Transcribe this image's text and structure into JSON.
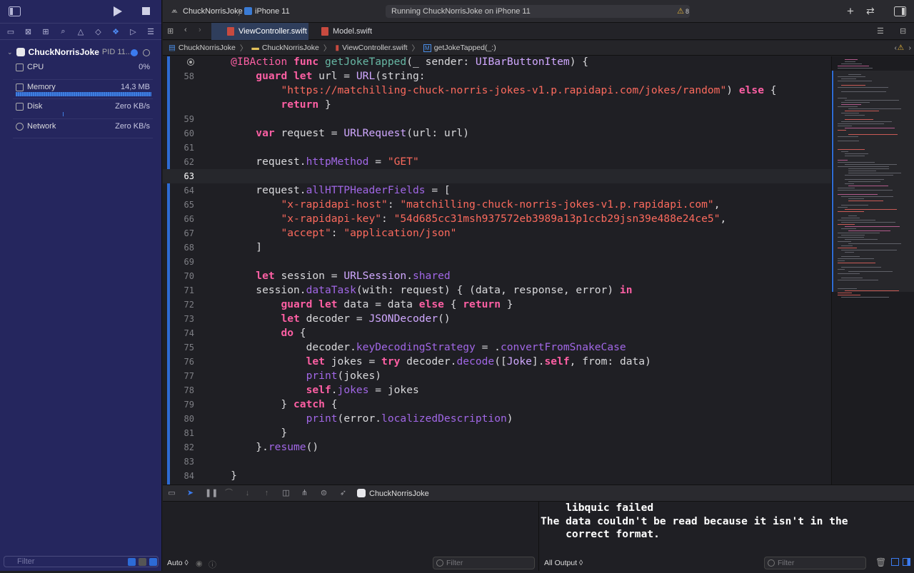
{
  "sidebar": {
    "process": {
      "name": "ChuckNorrisJoke",
      "pid": "PID 11..."
    },
    "gauges": [
      {
        "label": "CPU",
        "value": "0%"
      },
      {
        "label": "Memory",
        "value": "14,3 MB"
      },
      {
        "label": "Disk",
        "value": "Zero KB/s"
      },
      {
        "label": "Network",
        "value": "Zero KB/s"
      }
    ],
    "filter_placeholder": "Filter"
  },
  "toolbar": {
    "scheme": "ChuckNorrisJoke",
    "device": "iPhone 11",
    "status": "Running ChuckNorrisJoke on iPhone 11",
    "warnings": "8"
  },
  "tabs": [
    {
      "label": "ViewController.swift",
      "active": true
    },
    {
      "label": "Model.swift",
      "active": false
    }
  ],
  "jumpbar": [
    "ChuckNorrisJoke",
    "ChuckNorrisJoke",
    "ViewController.swift",
    "getJokeTapped(_:)"
  ],
  "code": {
    "line_numbers": [
      "",
      "58",
      "",
      "",
      "59",
      "60",
      "61",
      "62",
      "63",
      "64",
      "65",
      "66",
      "67",
      "68",
      "69",
      "70",
      "71",
      "72",
      "73",
      "74",
      "75",
      "76",
      "77",
      "78",
      "79",
      "80",
      "81",
      "82",
      "83",
      "84"
    ]
  },
  "debug": {
    "process": "ChuckNorrisJoke",
    "auto_label": "Auto ◊",
    "vars_filter": "Filter",
    "output_label": "All Output ◊",
    "console_filter": "Filter",
    "console_text": "    libquic failed\nThe data couldn't be read because it isn't in the\n    correct format."
  },
  "colors": {
    "accent": "#2e6bd3",
    "keyword": "#fc5fa3",
    "string": "#fc6a5d",
    "sidebar": "#25265e"
  }
}
